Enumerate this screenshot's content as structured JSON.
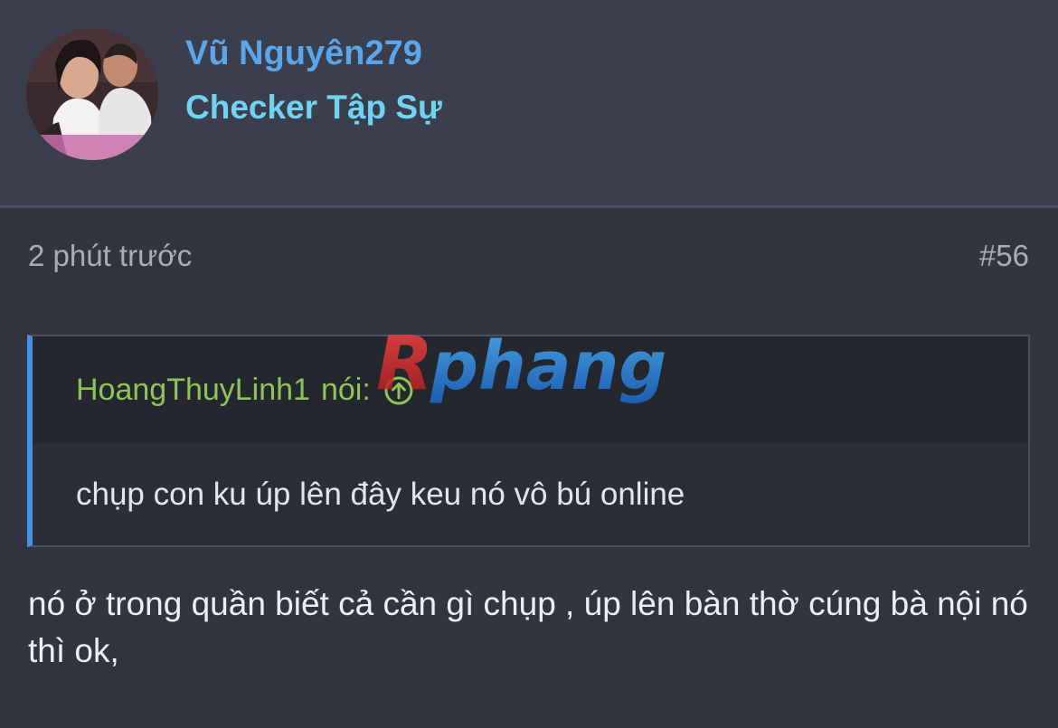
{
  "user": {
    "name": "Vũ Nguyên279",
    "title": "Checker Tập Sự",
    "avatar_icon": "avatar-photo"
  },
  "post": {
    "time": "2 phút trước",
    "number": "#56",
    "message": "nó ở trong quần biết cả cần gì chụp , úp lên bàn thờ cúng bà nội nó thì ok,"
  },
  "quote": {
    "author": "HoangThuyLinh1",
    "said_label": "nói:",
    "goto_icon": "arrow-up-circle-icon",
    "body": "chụp con ku úp lên đây keu nó vô bú online"
  },
  "watermark": {
    "text": "Rphang"
  },
  "colors": {
    "background": "#32353f",
    "header_bg": "#3b3f4d",
    "username": "#5aa6ea",
    "user_title": "#72d3f0",
    "quote_author": "#8fc45a",
    "quote_border": "#4a90e2"
  }
}
